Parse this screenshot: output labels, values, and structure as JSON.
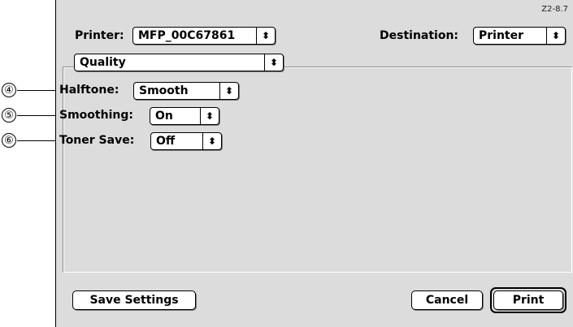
{
  "figure_ref": "Z2-8.7",
  "printer": {
    "label": "Printer:",
    "value": "MFP_00C67861"
  },
  "destination": {
    "label": "Destination:",
    "value": "Printer"
  },
  "panel_select": {
    "value": "Quality"
  },
  "settings": [
    {
      "callout": "④",
      "label": "Halftone:",
      "value": "Smooth"
    },
    {
      "callout": "⑤",
      "label": "Smoothing:",
      "value": "On"
    },
    {
      "callout": "⑥",
      "label": "Toner Save:",
      "value": "Off"
    }
  ],
  "buttons": {
    "save": "Save Settings",
    "cancel": "Cancel",
    "print": "Print"
  },
  "icons": {
    "popup_arrows": "⬍"
  }
}
